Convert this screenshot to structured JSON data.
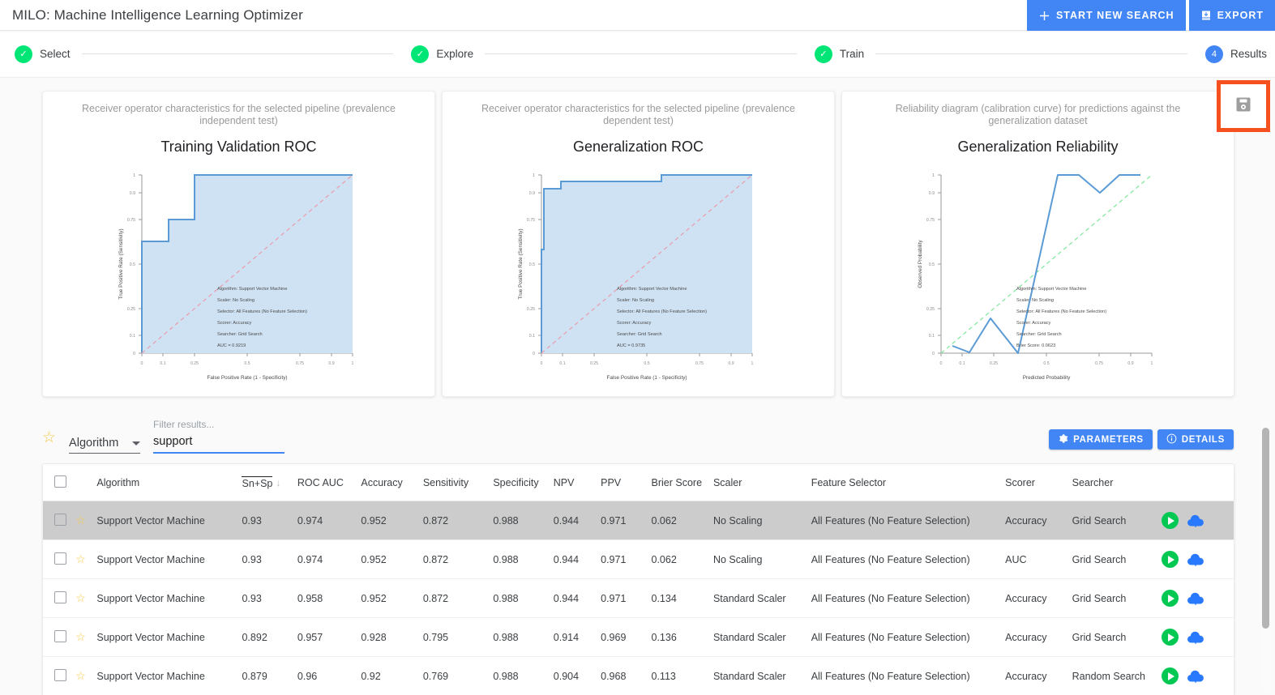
{
  "app": {
    "title": "MILO: Machine Intelligence Learning Optimizer",
    "buttons": [
      {
        "label": "START NEW SEARCH",
        "icon": "plus-icon"
      },
      {
        "label": "EXPORT",
        "icon": "export-icon"
      }
    ],
    "accent_color": "#4285f4",
    "highlight_color": "#f4511e",
    "save_icon": "save-floppy-icon"
  },
  "stepper": {
    "steps": [
      {
        "label": "Select",
        "state": "done",
        "marker": "check"
      },
      {
        "label": "Explore",
        "state": "done",
        "marker": "check"
      },
      {
        "label": "Train",
        "state": "done",
        "marker": "check"
      },
      {
        "label": "Results",
        "state": "active",
        "marker": "4"
      }
    ]
  },
  "cards": [
    {
      "subtitle": "Receiver operator characteristics for the selected pipeline (prevalence independent test)",
      "title": "Training Validation ROC"
    },
    {
      "subtitle": "Receiver operator characteristics for the selected pipeline (prevalence dependent test)",
      "title": "Generalization ROC"
    },
    {
      "subtitle": "Reliability diagram (calibration curve) for predictions against the generalization dataset",
      "title": "Generalization Reliability"
    }
  ],
  "chart_data": [
    {
      "type": "line",
      "title": "Training Validation ROC",
      "xlabel": "False Positive Rate (1 - Specificity)",
      "ylabel": "True Positive Rate (Sensitivity)",
      "xlim": [
        0,
        1
      ],
      "ylim": [
        0,
        1
      ],
      "xticks": [
        "0",
        "0.1",
        "0.25",
        "0.5",
        "0.75",
        "0.9",
        "1"
      ],
      "xtickvals": [
        0,
        0.1,
        0.25,
        0.5,
        0.75,
        0.9,
        1
      ],
      "yticks": [
        "0",
        "0.1",
        "0.25",
        "0.5",
        "0.75",
        "0.9",
        "1"
      ],
      "ytickvals": [
        0,
        0.1,
        0.25,
        0.5,
        0.75,
        0.9,
        1
      ],
      "grid": false,
      "series": [
        {
          "name": "ROC curve",
          "color": "#5b9bd5",
          "fill": "#cfe2f3",
          "x": [
            0,
            0,
            0.125,
            0.125,
            0.25,
            0.25,
            1
          ],
          "y": [
            0,
            0.625,
            0.625,
            0.75,
            0.75,
            1,
            1
          ]
        },
        {
          "name": "chance diagonal",
          "color": "#e8a0b0",
          "style": "dashed",
          "x": [
            0,
            1
          ],
          "y": [
            0,
            1
          ]
        }
      ],
      "annotations": [
        "Algorithm: Support Vector Machine",
        "Scaler: No Scaling",
        "Selector: All Features (No Feature Selection)",
        "Scorer: Accuracy",
        "Searcher: Grid Search",
        "AUC = 0.9219"
      ]
    },
    {
      "type": "line",
      "title": "Generalization ROC",
      "xlabel": "False Positive Rate (1 - Specificity)",
      "ylabel": "True Positive Rate (Sensitivity)",
      "xlim": [
        0,
        1
      ],
      "ylim": [
        0,
        1
      ],
      "xticks": [
        "0",
        "0.1",
        "0.25",
        "0.5",
        "0.75",
        "0.9",
        "1"
      ],
      "xtickvals": [
        0,
        0.1,
        0.25,
        0.5,
        0.75,
        0.9,
        1
      ],
      "yticks": [
        "0",
        "0.1",
        "0.25",
        "0.5",
        "0.75",
        "0.9",
        "1"
      ],
      "ytickvals": [
        0,
        0.1,
        0.25,
        0.5,
        0.75,
        0.9,
        1
      ],
      "grid": false,
      "series": [
        {
          "name": "ROC curve",
          "color": "#5b9bd5",
          "fill": "#cfe2f3",
          "x": [
            0,
            0,
            0.012,
            0.012,
            0.092,
            0.092,
            0.57,
            0.57,
            1
          ],
          "y": [
            0,
            0.58,
            0.58,
            0.925,
            0.925,
            0.965,
            0.965,
            1,
            1
          ]
        },
        {
          "name": "chance diagonal",
          "color": "#e8a0b0",
          "style": "dashed",
          "x": [
            0,
            1
          ],
          "y": [
            0,
            1
          ]
        }
      ],
      "annotations": [
        "Algorithm: Support Vector Machine",
        "Scaler: No Scaling",
        "Selector: All Features (No Feature Selection)",
        "Scorer: Accuracy",
        "Searcher: Grid Search",
        "AUC = 0.9735"
      ]
    },
    {
      "type": "line",
      "title": "Generalization Reliability",
      "xlabel": "Predicted Probability",
      "ylabel": "Observed Probability",
      "xlim": [
        0,
        1
      ],
      "ylim": [
        0,
        1
      ],
      "xticks": [
        "0",
        "0.1",
        "0.25",
        "0.5",
        "0.75",
        "0.9",
        "1"
      ],
      "xtickvals": [
        0,
        0.1,
        0.25,
        0.5,
        0.75,
        0.9,
        1
      ],
      "yticks": [
        "0",
        "0.1",
        "0.25",
        "0.5",
        "0.75",
        "0.9",
        "1"
      ],
      "ytickvals": [
        0,
        0.1,
        0.25,
        0.5,
        0.75,
        0.9,
        1
      ],
      "grid": false,
      "series": [
        {
          "name": "calibration curve",
          "color": "#5b9bd5",
          "x": [
            0.055,
            0.135,
            0.235,
            0.365,
            0.555,
            0.655,
            0.755,
            0.845,
            0.945
          ],
          "y": [
            0.04,
            0.005,
            0.195,
            0.0,
            1.0,
            1.0,
            0.9,
            1.0,
            1.0
          ]
        },
        {
          "name": "perfect calibration",
          "color": "#87e8a0",
          "style": "dashed",
          "x": [
            0,
            1
          ],
          "y": [
            0,
            1
          ]
        }
      ],
      "annotations": [
        "Algorithm: Support Vector Machine",
        "Scaler: No Scaling",
        "Selector: All Features (No Feature Selection)",
        "Scorer: Accuracy",
        "Searcher: Grid Search",
        "Brier Score: 0.0623"
      ]
    }
  ],
  "filterbar": {
    "star_icon": "star-icon",
    "select_value": "Algorithm",
    "filter_label": "Filter results...",
    "filter_value": "support",
    "parameters_label": "PARAMETERS",
    "details_label": "DETAILS"
  },
  "table": {
    "columns": [
      "Algorithm",
      "Sn+Sp",
      "ROC AUC",
      "Accuracy",
      "Sensitivity",
      "Specificity",
      "NPV",
      "PPV",
      "Brier Score",
      "Scaler",
      "Feature Selector",
      "Scorer",
      "Searcher"
    ],
    "sorted_column": "Sn+Sp",
    "sort_direction": "desc",
    "rows": [
      {
        "selected": true,
        "algorithm": "Support Vector Machine",
        "sn_sp": "0.93",
        "roc_auc": "0.974",
        "accuracy": "0.952",
        "sensitivity": "0.872",
        "specificity": "0.988",
        "npv": "0.944",
        "ppv": "0.971",
        "brier": "0.062",
        "scaler": "No Scaling",
        "selector": "All Features (No Feature Selection)",
        "scorer": "Accuracy",
        "searcher": "Grid Search"
      },
      {
        "selected": false,
        "algorithm": "Support Vector Machine",
        "sn_sp": "0.93",
        "roc_auc": "0.974",
        "accuracy": "0.952",
        "sensitivity": "0.872",
        "specificity": "0.988",
        "npv": "0.944",
        "ppv": "0.971",
        "brier": "0.062",
        "scaler": "No Scaling",
        "selector": "All Features (No Feature Selection)",
        "scorer": "AUC",
        "searcher": "Grid Search"
      },
      {
        "selected": false,
        "algorithm": "Support Vector Machine",
        "sn_sp": "0.93",
        "roc_auc": "0.958",
        "accuracy": "0.952",
        "sensitivity": "0.872",
        "specificity": "0.988",
        "npv": "0.944",
        "ppv": "0.971",
        "brier": "0.134",
        "scaler": "Standard Scaler",
        "selector": "All Features (No Feature Selection)",
        "scorer": "Accuracy",
        "searcher": "Grid Search"
      },
      {
        "selected": false,
        "algorithm": "Support Vector Machine",
        "sn_sp": "0.892",
        "roc_auc": "0.957",
        "accuracy": "0.928",
        "sensitivity": "0.795",
        "specificity": "0.988",
        "npv": "0.914",
        "ppv": "0.969",
        "brier": "0.136",
        "scaler": "Standard Scaler",
        "selector": "All Features (No Feature Selection)",
        "scorer": "Accuracy",
        "searcher": "Grid Search"
      },
      {
        "selected": false,
        "algorithm": "Support Vector Machine",
        "sn_sp": "0.879",
        "roc_auc": "0.96",
        "accuracy": "0.92",
        "sensitivity": "0.769",
        "specificity": "0.988",
        "npv": "0.904",
        "ppv": "0.968",
        "brier": "0.113",
        "scaler": "Standard Scaler",
        "selector": "All Features (No Feature Selection)",
        "scorer": "Accuracy",
        "searcher": "Random Search"
      }
    ]
  }
}
